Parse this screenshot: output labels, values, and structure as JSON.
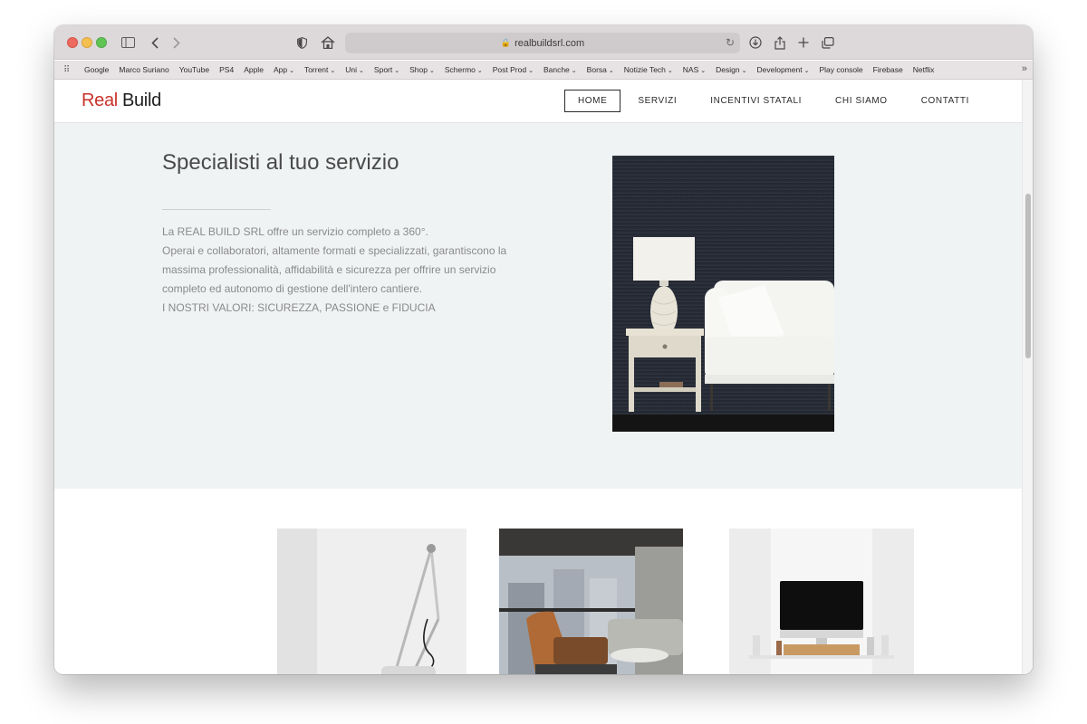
{
  "browser": {
    "url": "realbuildsrl.com",
    "bookmarks": [
      {
        "label": "Google",
        "menu": false
      },
      {
        "label": "Marco Suriano",
        "menu": false
      },
      {
        "label": "YouTube",
        "menu": false
      },
      {
        "label": "PS4",
        "menu": false
      },
      {
        "label": "Apple",
        "menu": false
      },
      {
        "label": "App",
        "menu": true
      },
      {
        "label": "Torrent",
        "menu": true
      },
      {
        "label": "Uni",
        "menu": true
      },
      {
        "label": "Sport",
        "menu": true
      },
      {
        "label": "Shop",
        "menu": true
      },
      {
        "label": "Schermo",
        "menu": true
      },
      {
        "label": "Post Prod",
        "menu": true
      },
      {
        "label": "Banche",
        "menu": true
      },
      {
        "label": "Borsa",
        "menu": true
      },
      {
        "label": "Notizie Tech",
        "menu": true
      },
      {
        "label": "NAS",
        "menu": true
      },
      {
        "label": "Design",
        "menu": true
      },
      {
        "label": "Development",
        "menu": true
      },
      {
        "label": "Play console",
        "menu": false
      },
      {
        "label": "Firebase",
        "menu": false
      },
      {
        "label": "Netflix",
        "menu": false
      }
    ]
  },
  "site": {
    "logo": {
      "real": "Real",
      "build": "Build"
    },
    "nav": [
      "HOME",
      "SERVIZI",
      "INCENTIVI STATALI",
      "CHI SIAMO",
      "CONTATTI"
    ],
    "active_nav": "HOME",
    "hero": {
      "title": "Specialisti al tuo servizio",
      "paragraphs": [
        "La REAL BUILD SRL offre un servizio completo a 360°.",
        "Operai e collaboratori, altamente formati e specializzati, garantiscono la massima professionalità, affidabilità e sicurezza per offrire un servizio completo ed autonomo di gestione dell'intero cantiere.",
        "I NOSTRI VALORI: SICUREZZA, PASSIONE e FIDUCIA"
      ]
    }
  },
  "colors": {
    "brand_red": "#c8332b",
    "hero_bg": "#f0f3f4",
    "text_gray": "#8a8a8a"
  }
}
